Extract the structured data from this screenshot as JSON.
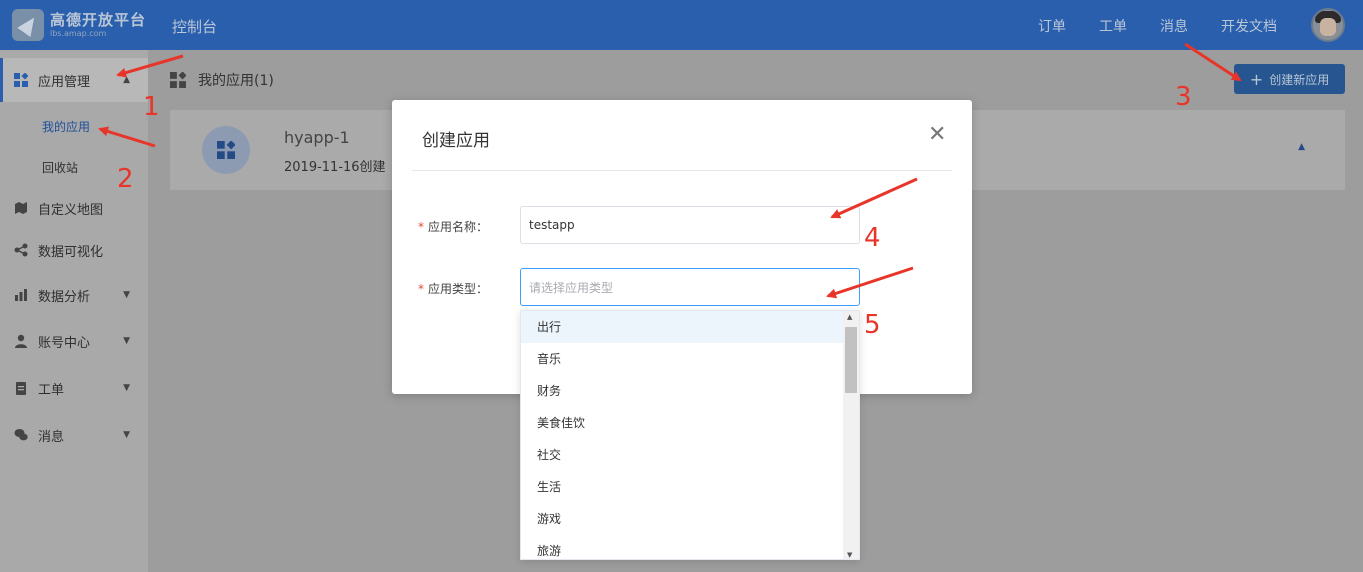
{
  "header": {
    "logo_cn": "高德开放平台",
    "logo_en": "lbs.amap.com",
    "console": "控制台",
    "nav": [
      "订单",
      "工单",
      "消息",
      "开发文档"
    ]
  },
  "sidebar": {
    "items": [
      {
        "label": "应用管理",
        "icon": "grid-icon"
      },
      {
        "label": "自定义地图",
        "icon": "map-icon"
      },
      {
        "label": "数据可视化",
        "icon": "share-icon"
      },
      {
        "label": "数据分析",
        "icon": "bar-chart-icon"
      },
      {
        "label": "账号中心",
        "icon": "user-icon"
      },
      {
        "label": "工单",
        "icon": "clipboard-icon"
      },
      {
        "label": "消息",
        "icon": "chat-icon"
      }
    ],
    "subitems": [
      "我的应用",
      "回收站"
    ]
  },
  "main": {
    "page_title": "我的应用(1)",
    "create_button": "创建新应用",
    "app": {
      "name": "hyapp-1",
      "date": "2019-11-16创建"
    }
  },
  "modal": {
    "title": "创建应用",
    "name_label": "应用名称：",
    "name_value": "testapp",
    "type_label": "应用类型：",
    "type_placeholder": "请选择应用类型",
    "options": [
      "出行",
      "音乐",
      "财务",
      "美食佳饮",
      "社交",
      "生活",
      "游戏",
      "旅游"
    ]
  },
  "annotations": [
    "1",
    "2",
    "3",
    "4",
    "5"
  ],
  "colors": {
    "primary": "#2a5fae",
    "annotation": "#e8352a",
    "required": "#e24c3c"
  }
}
